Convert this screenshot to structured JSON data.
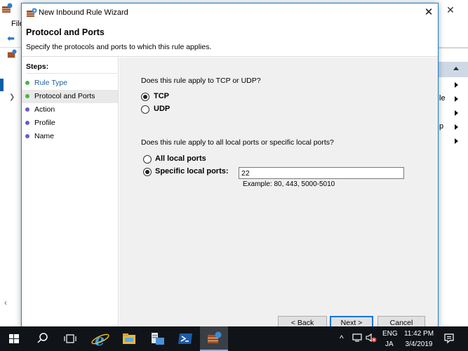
{
  "background_app": {
    "menu_partial": "File",
    "right_panel_partial": [
      "le",
      "p"
    ]
  },
  "wizard": {
    "title": "New Inbound Rule Wizard",
    "heading": "Protocol and Ports",
    "subheading": "Specify the protocols and ports to which this rule applies.",
    "steps_label": "Steps:",
    "steps": [
      {
        "label": "Rule Type",
        "state": "done",
        "dot_color": "#4bb543",
        "text_color": "#1f5fa6"
      },
      {
        "label": "Protocol and Ports",
        "state": "current",
        "dot_color": "#4bb543",
        "text_color": "#000000"
      },
      {
        "label": "Action",
        "state": "pending",
        "dot_color": "#6a5acd",
        "text_color": "#000000"
      },
      {
        "label": "Profile",
        "state": "pending",
        "dot_color": "#6a5acd",
        "text_color": "#000000"
      },
      {
        "label": "Name",
        "state": "pending",
        "dot_color": "#6a5acd",
        "text_color": "#000000"
      }
    ],
    "protocol_question": "Does this rule apply to TCP or UDP?",
    "protocol_options": [
      {
        "label": "TCP",
        "checked": true
      },
      {
        "label": "UDP",
        "checked": false
      }
    ],
    "ports_question": "Does this rule apply to all local ports or specific local ports?",
    "port_options": [
      {
        "label": "All local ports",
        "checked": false
      },
      {
        "label": "Specific local ports:",
        "checked": true
      }
    ],
    "ports_value": "22",
    "ports_example": "Example: 80, 443, 5000-5010",
    "buttons": {
      "back": "< Back",
      "next": "Next >",
      "cancel": "Cancel"
    }
  },
  "taskbar": {
    "lang_top": "ENG",
    "lang_bottom": "JA",
    "time": "11:42 PM",
    "date": "3/4/2019",
    "accent_color": "#7fb2e6"
  }
}
